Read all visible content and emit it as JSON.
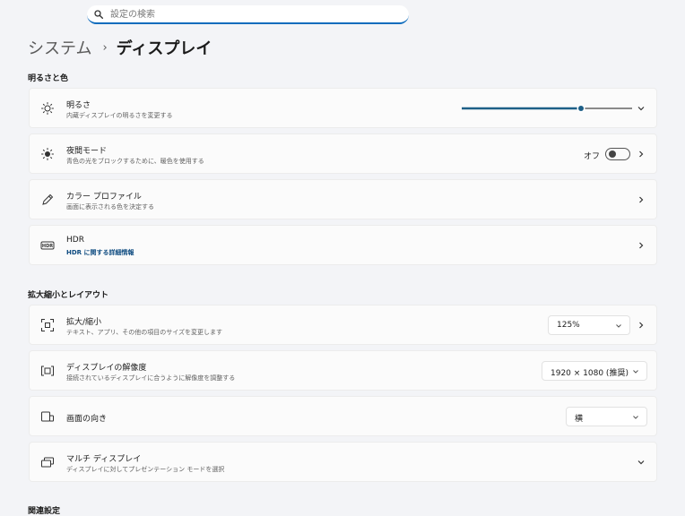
{
  "search": {
    "placeholder": "設定の検索",
    "icon": "search-icon"
  },
  "breadcrumb": {
    "parent": "システム",
    "separator": "›",
    "current": "ディスプレイ"
  },
  "sections": {
    "brightness_color": "明るさと色",
    "scale_layout": "拡大縮小とレイアウト",
    "related": "関連設定"
  },
  "settings": {
    "brightness": {
      "title": "明るさ",
      "subtitle": "内蔵ディスプレイの明るさを変更する",
      "level_percent": 70,
      "icon": "sun-icon"
    },
    "night_light": {
      "title": "夜間モード",
      "subtitle": "青色の光をブロックするために、暖色を使用する",
      "state_label": "オフ",
      "on": false,
      "icon": "night-light-icon"
    },
    "color_profile": {
      "title": "カラー プロファイル",
      "subtitle": "画面に表示される色を決定する",
      "icon": "pen-icon"
    },
    "hdr": {
      "title": "HDR",
      "subtitle": "HDR に関する詳細情報",
      "icon": "hdr-icon"
    },
    "scale": {
      "title": "拡大/縮小",
      "subtitle": "テキスト、アプリ、その他の項目のサイズを変更します",
      "value": "125%",
      "icon": "scale-icon"
    },
    "resolution": {
      "title": "ディスプレイの解像度",
      "subtitle": "接続されているディスプレイに合うように解像度を調整する",
      "value": "1920 × 1080 (推奨)",
      "icon": "resolution-icon"
    },
    "orientation": {
      "title": "画面の向き",
      "value": "横",
      "icon": "orientation-icon"
    },
    "multi_display": {
      "title": "マルチ ディスプレイ",
      "subtitle": "ディスプレイに対してプレゼンテーション モードを選択",
      "icon": "multi-display-icon"
    }
  },
  "colors": {
    "accent": "#0f6cbd",
    "slider_fill": "#1d5f87",
    "background": "#f3f4f7",
    "card": "#fbfbfb"
  }
}
